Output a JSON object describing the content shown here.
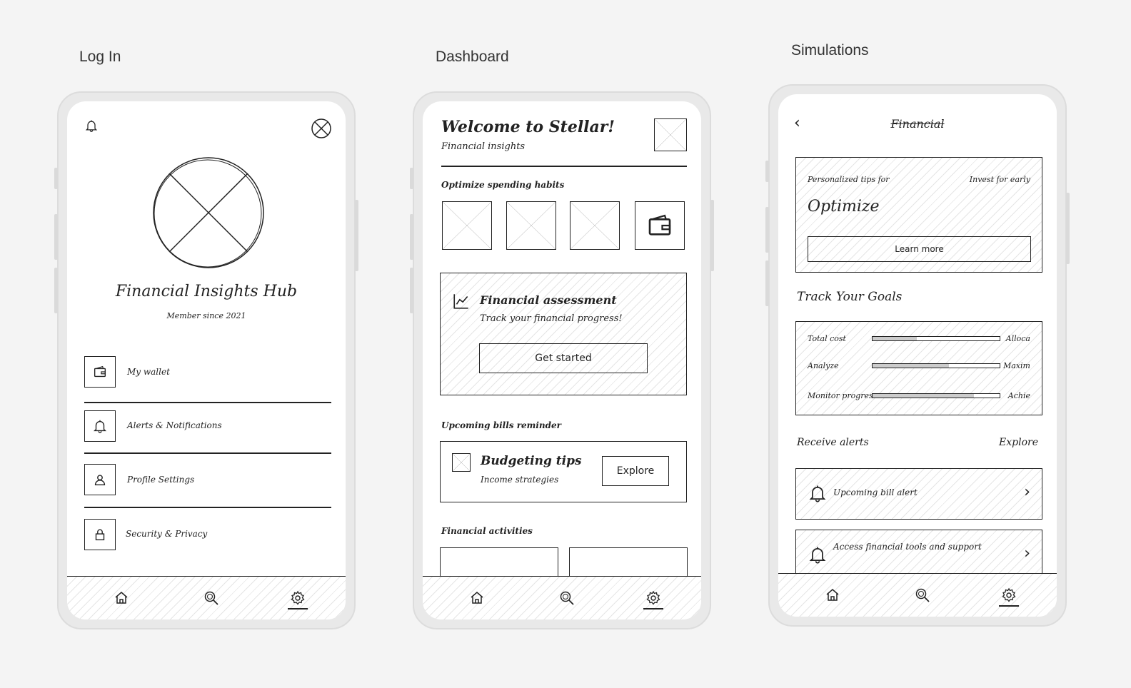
{
  "labels": {
    "login": "Log In",
    "dashboard": "Dashboard",
    "simulations": "Simulations"
  },
  "login": {
    "title": "Financial Insights Hub",
    "subtitle": "Member since 2021",
    "menu": [
      {
        "label": "My wallet",
        "icon": "wallet-icon"
      },
      {
        "label": "Alerts & Notifications",
        "icon": "bell-icon"
      },
      {
        "label": "Profile Settings",
        "icon": "user-icon"
      },
      {
        "label": "Security & Privacy",
        "icon": "lock-icon"
      }
    ]
  },
  "dashboard": {
    "title": "Welcome to Stellar!",
    "subtitle": "Financial insights",
    "section1": "Optimize spending habits",
    "assessment": {
      "title": "Financial assessment",
      "subtitle": "Track your financial progress!",
      "button": "Get started"
    },
    "section2": "Upcoming bills reminder",
    "tips": {
      "title": "Budgeting tips",
      "subtitle": "Income strategies",
      "button": "Explore"
    },
    "section3": "Financial activities"
  },
  "simulations": {
    "header_title": "Financial",
    "promo": {
      "left_caption": "Personalized tips for",
      "right_caption": "Invest for early",
      "title": "Optimize",
      "button": "Learn more"
    },
    "goals_title": "Track Your Goals",
    "goals": [
      {
        "label": "Total cost",
        "right": "Alloca",
        "progress": 0.35
      },
      {
        "label": "Analyze",
        "right": "Maxim",
        "progress": 0.6
      },
      {
        "label": "Monitor progress",
        "right": "Achie",
        "progress": 0.8
      }
    ],
    "alerts_title": "Receive alerts",
    "alerts_link": "Explore",
    "alerts": [
      {
        "label": "Upcoming bill alert"
      },
      {
        "label": "Access financial tools and support"
      }
    ]
  }
}
